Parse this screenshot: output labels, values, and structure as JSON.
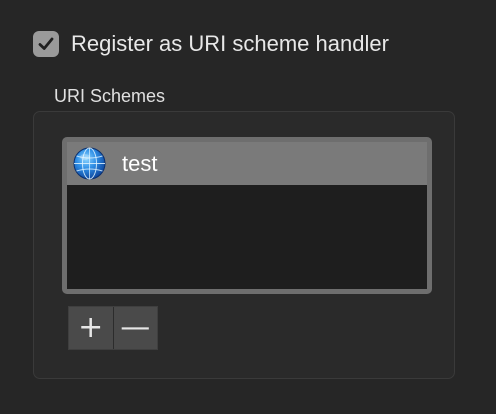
{
  "register_checkbox": {
    "label": "Register as URI scheme handler",
    "checked": true
  },
  "uri_schemes": {
    "title": "URI Schemes",
    "items": [
      {
        "label": "test",
        "icon": "globe-icon",
        "selected": true
      }
    ]
  },
  "list_buttons": {
    "add_label": "+",
    "remove_label": "—"
  },
  "colors": {
    "background": "#262626",
    "group_background": "#2a2a2a",
    "list_frame": "#6e6e6e",
    "list_background": "#1e1e1e",
    "selected_row": "#7a7a7a",
    "checkbox_fill": "#9a9a9a"
  }
}
